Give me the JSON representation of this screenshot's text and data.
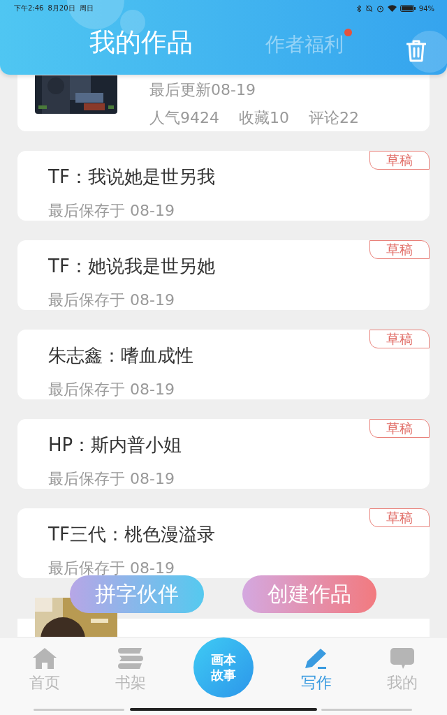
{
  "status_bar": {
    "time": "下午2:46",
    "date": "8月20日",
    "weekday": "周日",
    "battery": "94%"
  },
  "tabs": [
    {
      "label": "我的作品",
      "selected": true,
      "notification": false
    },
    {
      "label": "作者福利",
      "selected": false,
      "notification": true
    }
  ],
  "published": [
    {
      "kind": "picture",
      "updated": "最后更新08-19",
      "stats": [
        "人气9424",
        "收藏10",
        "评论22"
      ]
    }
  ],
  "drafts": [
    {
      "title": "TF：我说她是世另我",
      "saved": "最后保存于 08-19",
      "badge": "草稿"
    },
    {
      "title": "TF：她说我是世另她",
      "saved": "最后保存于 08-19",
      "badge": "草稿"
    },
    {
      "title": "朱志鑫：嗜血成性",
      "saved": "最后保存于 08-19",
      "badge": "草稿"
    },
    {
      "title": "HP：斯内普小姐",
      "saved": "最后保存于 08-19",
      "badge": "草稿"
    },
    {
      "title": "TF三代：桃色漫溢录",
      "saved": "最后保存于 08-19",
      "badge": "草稿"
    }
  ],
  "floating_buttons": [
    {
      "label": "拼字伙伴",
      "kind": "partner"
    },
    {
      "label": "创建作品",
      "kind": "create"
    }
  ],
  "nav": [
    {
      "label": "首页",
      "kind": "home",
      "selected": false
    },
    {
      "label": "书架",
      "kind": "shelf",
      "selected": false
    },
    {
      "label": "写作",
      "kind": "write",
      "selected": true
    },
    {
      "label": "我的",
      "kind": "me",
      "selected": false
    }
  ],
  "center_button": {
    "lines": [
      "画本",
      "故事"
    ]
  }
}
